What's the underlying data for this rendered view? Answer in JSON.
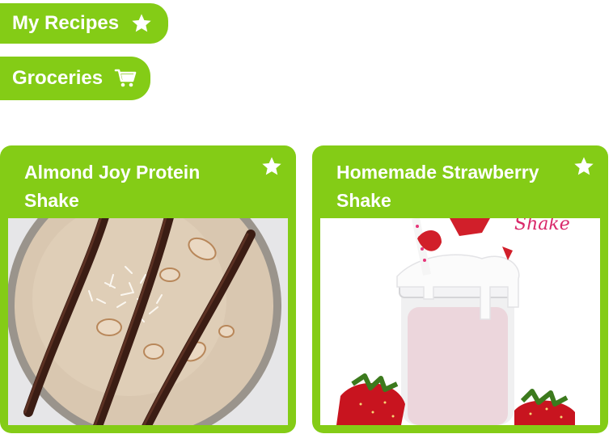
{
  "accent_color": "#84cc16",
  "nav": {
    "my_recipes": {
      "label": "My Recipes",
      "icon": "star-icon"
    },
    "groceries": {
      "label": "Groceries",
      "icon": "cart-icon"
    }
  },
  "recipes": [
    {
      "title": "Almond Joy Protein Shake",
      "favorite_icon": "star-icon",
      "image": "almond-joy-shake-photo"
    },
    {
      "title": "Homemade Strawberry Shake",
      "favorite_icon": "star-icon",
      "image": "strawberry-shake-photo",
      "image_caption": "Shake"
    }
  ]
}
